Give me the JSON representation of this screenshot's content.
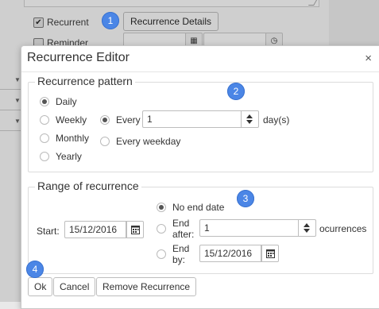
{
  "background": {
    "recurrent_label": "Recurrent",
    "recurrent_checked": true,
    "recurrence_details_label": "Recurrence Details",
    "reminder_label": "Reminder"
  },
  "badges": [
    "1",
    "2",
    "3",
    "4"
  ],
  "dialog": {
    "title": "Recurrence Editor",
    "close_glyph": "×",
    "pattern": {
      "legend": "Recurrence pattern",
      "options": [
        "Daily",
        "Weekly",
        "Monthly",
        "Yearly"
      ],
      "selected": "Daily",
      "every_label": "Every",
      "every_value": "1",
      "unit": "day(s)",
      "every_weekday_label": "Every weekday"
    },
    "range": {
      "legend": "Range of recurrence",
      "start_label": "Start:",
      "start_value": "15/12/2016",
      "no_end_label": "No end date",
      "end_after_label_1": "End",
      "end_after_label_2": "after:",
      "end_after_value": "1",
      "occurrences_label": "ocurrences",
      "end_by_label_1": "End",
      "end_by_label_2": "by:",
      "end_by_value": "15/12/2016",
      "selected": "No end date"
    },
    "buttons": {
      "ok": "Ok",
      "cancel": "Cancel",
      "remove": "Remove Recurrence"
    }
  },
  "colors": {
    "badge": "#4b86e6",
    "overlay": "#c8c8c8"
  }
}
